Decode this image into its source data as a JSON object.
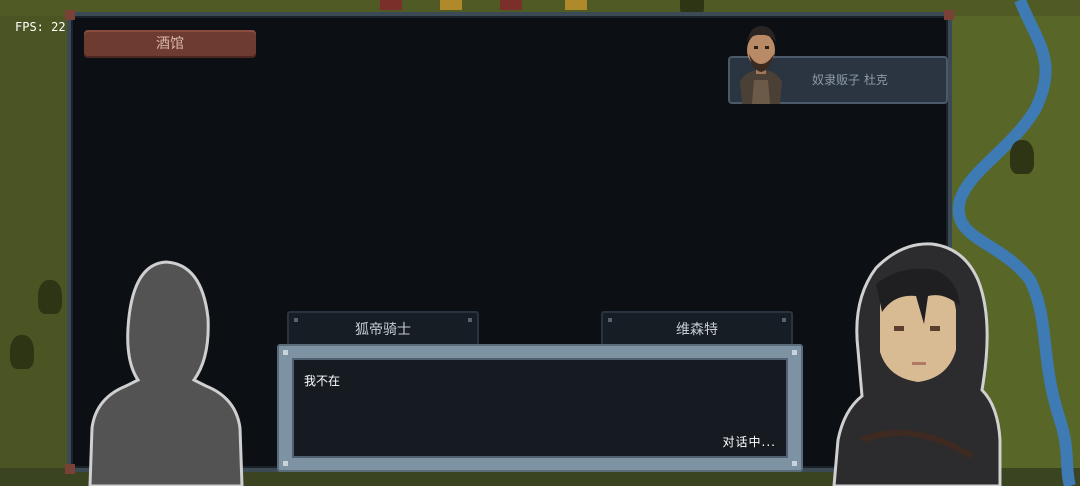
{
  "hud": {
    "fps_label": "FPS: 22"
  },
  "location": {
    "name": "酒馆"
  },
  "participant": {
    "name": "奴隶贩子 杜克",
    "portrait": "bearded-man-portrait"
  },
  "speakers": {
    "left": "狐帝骑士",
    "right": "维森特"
  },
  "dialogue": {
    "text": "我不在",
    "status": "对话中..."
  },
  "characters": {
    "left": "player-silhouette",
    "right": "hooded-woman-portrait"
  },
  "colors": {
    "panel_bg": "#0c0f14",
    "location_tag": "#6e3b30",
    "dialogue_frame": "#7d93a4",
    "river": "#3e7ab3"
  }
}
